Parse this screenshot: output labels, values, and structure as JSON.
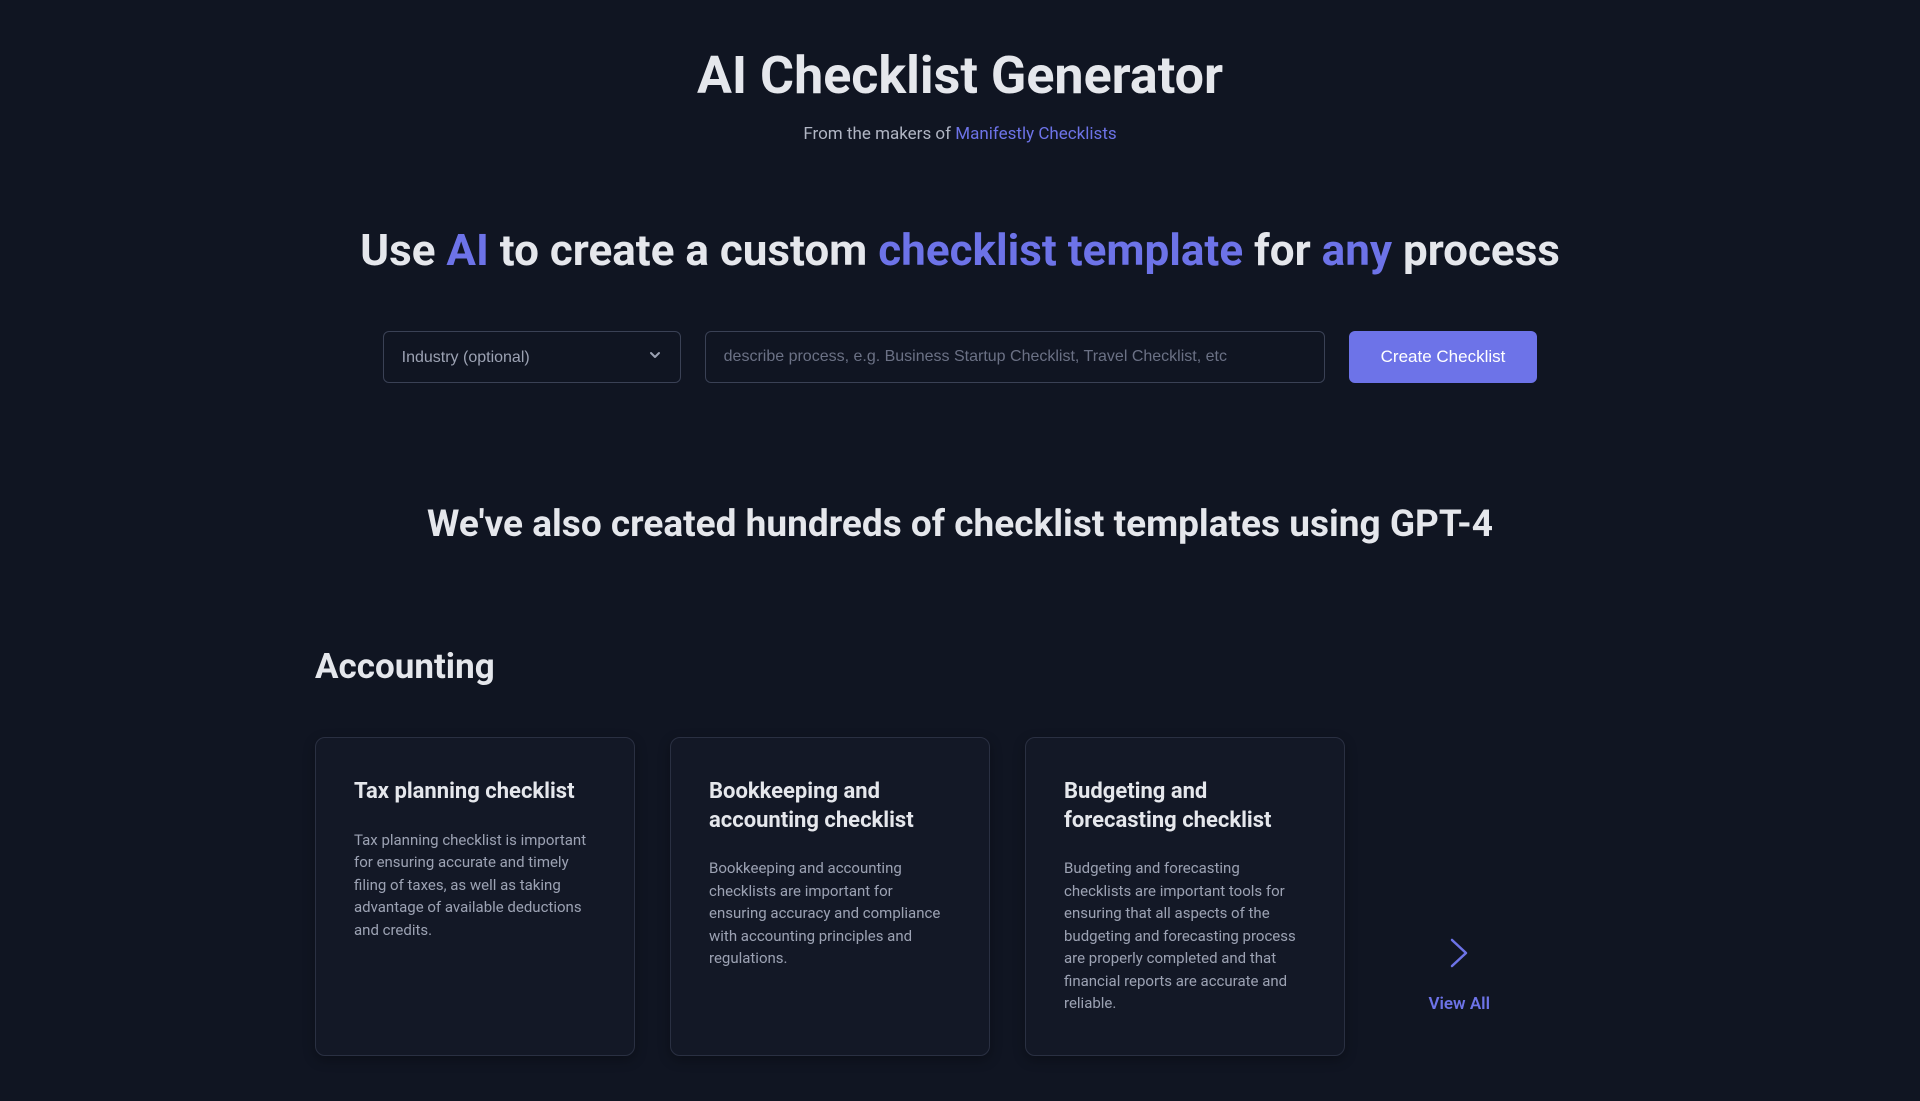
{
  "header": {
    "title": "AI Checklist Generator",
    "subtitle_prefix": "From the makers of ",
    "subtitle_link": "Manifestly Checklists"
  },
  "tagline": {
    "part1": "Use ",
    "h1": "AI",
    "part2": " to create a custom ",
    "h2": "checklist template",
    "part3": " for ",
    "h3": "any",
    "part4": " process"
  },
  "form": {
    "industry_placeholder": "Industry (optional)",
    "process_placeholder": "describe process, e.g. Business Startup Checklist, Travel Checklist, etc",
    "create_label": "Create Checklist"
  },
  "templates": {
    "heading": "We've also created hundreds of checklist templates using GPT-4",
    "category": "Accounting",
    "view_all": "View All",
    "cards": [
      {
        "title": "Tax planning checklist",
        "desc": "Tax planning checklist is important for ensuring accurate and timely filing of taxes, as well as taking advantage of available deductions and credits."
      },
      {
        "title": "Bookkeeping and accounting checklist",
        "desc": "Bookkeeping and accounting checklists are important for ensuring accuracy and compliance with accounting principles and regulations."
      },
      {
        "title": "Budgeting and forecasting checklist",
        "desc": "Budgeting and forecasting checklists are important tools for ensuring that all aspects of the budgeting and forecasting process are properly completed and that financial reports are accurate and reliable."
      }
    ]
  }
}
